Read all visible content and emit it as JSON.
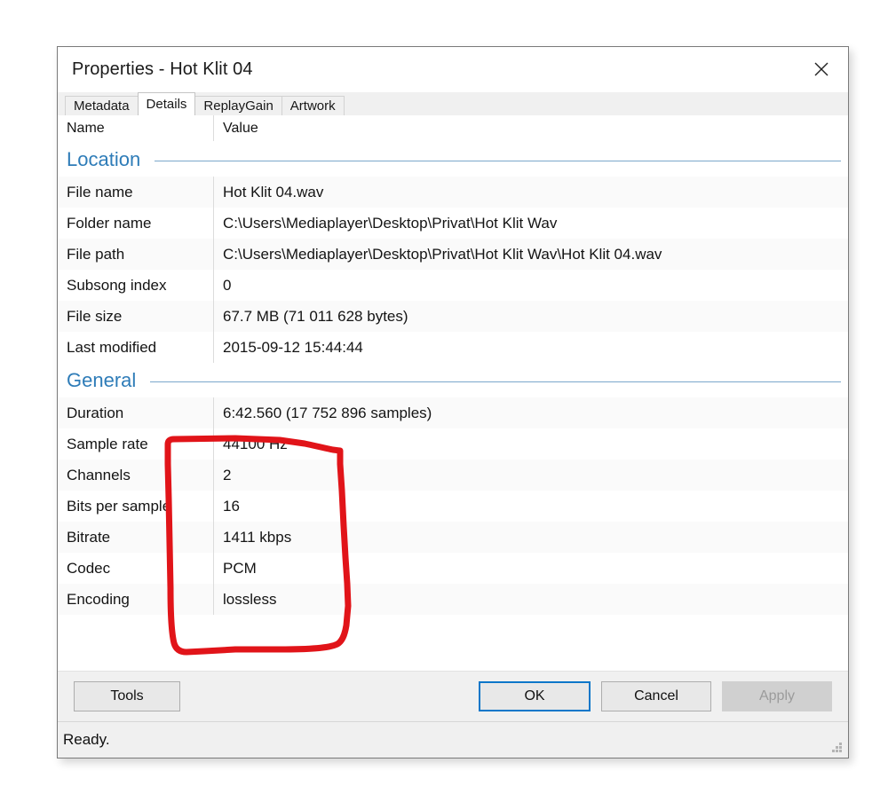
{
  "window": {
    "title": "Properties - Hot Klit 04",
    "close_icon": "close-icon"
  },
  "tabs": [
    {
      "label": "Metadata",
      "active": false
    },
    {
      "label": "Details",
      "active": true
    },
    {
      "label": "ReplayGain",
      "active": false
    },
    {
      "label": "Artwork",
      "active": false
    }
  ],
  "columns": {
    "name": "Name",
    "value": "Value"
  },
  "sections": [
    {
      "title": "Location",
      "rows": [
        {
          "name": "File name",
          "value": "Hot Klit 04.wav"
        },
        {
          "name": "Folder name",
          "value": "C:\\Users\\Mediaplayer\\Desktop\\Privat\\Hot Klit Wav"
        },
        {
          "name": "File path",
          "value": "C:\\Users\\Mediaplayer\\Desktop\\Privat\\Hot Klit Wav\\Hot Klit 04.wav"
        },
        {
          "name": "Subsong index",
          "value": "0"
        },
        {
          "name": "File size",
          "value": "67.7 MB (71 011 628 bytes)"
        },
        {
          "name": "Last modified",
          "value": "2015-09-12 15:44:44"
        }
      ]
    },
    {
      "title": "General",
      "rows": [
        {
          "name": "Duration",
          "value": "6:42.560 (17 752 896 samples)"
        },
        {
          "name": "Sample rate",
          "value": "44100 Hz"
        },
        {
          "name": "Channels",
          "value": "2"
        },
        {
          "name": "Bits per sample",
          "value": "16"
        },
        {
          "name": "Bitrate",
          "value": "1411 kbps"
        },
        {
          "name": "Codec",
          "value": "PCM"
        },
        {
          "name": "Encoding",
          "value": "lossless"
        }
      ]
    }
  ],
  "buttons": {
    "tools": "Tools",
    "ok": "OK",
    "cancel": "Cancel",
    "apply": "Apply"
  },
  "statusbar": {
    "text": "Ready.",
    "grip_icon": "resize-grip-icon"
  },
  "annotation": {
    "type": "freehand-circle",
    "color": "#e11419",
    "encloses": "Sample rate through Encoding values"
  },
  "colors": {
    "section_title": "#2e7cb8",
    "section_rule": "#7ba7cb",
    "focus_ring": "#0d77c9",
    "annotation_red": "#e11419",
    "window_border": "#7a7a7a",
    "chrome": "#f0f0f0"
  }
}
